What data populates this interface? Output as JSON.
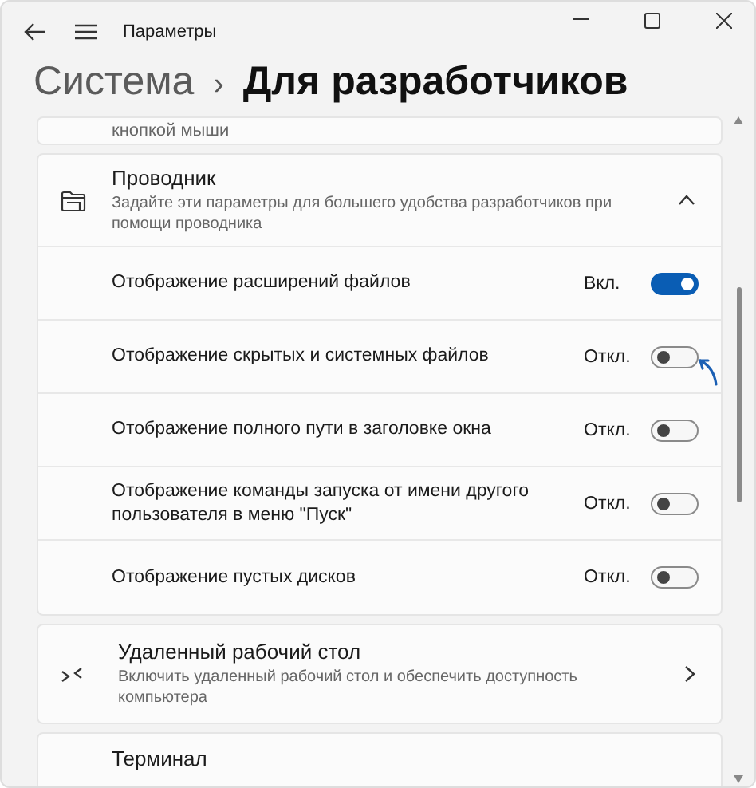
{
  "window": {
    "title": "Параметры"
  },
  "breadcrumb": {
    "parent": "Система",
    "separator": "›",
    "current": "Для разработчиков"
  },
  "previous_card": {
    "text": "кнопкой мыши"
  },
  "explorer": {
    "title": "Проводник",
    "description": "Задайте эти параметры для большего удобства разработчиков при помощи проводника",
    "expanded": true,
    "settings": [
      {
        "label": "Отображение расширений файлов",
        "state": "Вкл.",
        "on": true,
        "highlighted": false
      },
      {
        "label": "Отображение скрытых и системных файлов",
        "state": "Откл.",
        "on": false,
        "highlighted": true
      },
      {
        "label": "Отображение полного пути в заголовке окна",
        "state": "Откл.",
        "on": false,
        "highlighted": false
      },
      {
        "label": "Отображение команды запуска от имени другого пользователя в меню \"Пуск\"",
        "state": "Откл.",
        "on": false,
        "highlighted": false
      },
      {
        "label": "Отображение пустых дисков",
        "state": "Откл.",
        "on": false,
        "highlighted": false
      }
    ]
  },
  "remote_desktop": {
    "title": "Удаленный рабочий стол",
    "description": "Включить удаленный рабочий стол и обеспечить доступность компьютера"
  },
  "terminal": {
    "title": "Терминал"
  }
}
